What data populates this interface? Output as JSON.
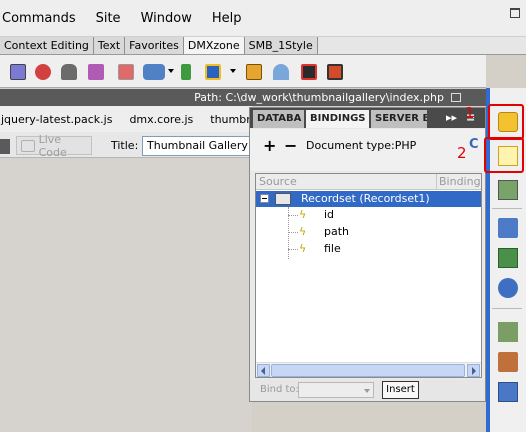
{
  "menu": {
    "items": [
      "Commands",
      "Site",
      "Window",
      "Help"
    ]
  },
  "insert_tabs": [
    "Context Editing",
    "Text",
    "Favorites",
    "DMXzone",
    "SMB_1Style"
  ],
  "active_tab": "DMXzone",
  "path_bar": {
    "path": "Path:  C:\\dw_work\\thumbnailgallery\\index.php"
  },
  "related_files": [
    "jquery-latest.pack.js",
    "dmx.core.js",
    "thumbnail_ga"
  ],
  "document_toolbar": {
    "live_code": "Live Code",
    "title_label": "Title:",
    "title_value": "Thumbnail Gallery"
  },
  "panel": {
    "tabs": [
      "DATABA",
      "BINDINGS",
      "SERVER B"
    ],
    "active_tab": "BINDINGS",
    "doc_type": "Document type:PHP",
    "columns": [
      "Source",
      "Binding"
    ],
    "recordset": "Recordset (Recordset1)",
    "fields": [
      "id",
      "path",
      "file"
    ],
    "bind_to_label": "Bind to:",
    "insert_button": "Insert"
  },
  "annotations": [
    "1",
    "2"
  ],
  "colors": {
    "selection": "#3169c6",
    "highlight": "#e30000",
    "strip_accent": "#2f6bd1"
  }
}
